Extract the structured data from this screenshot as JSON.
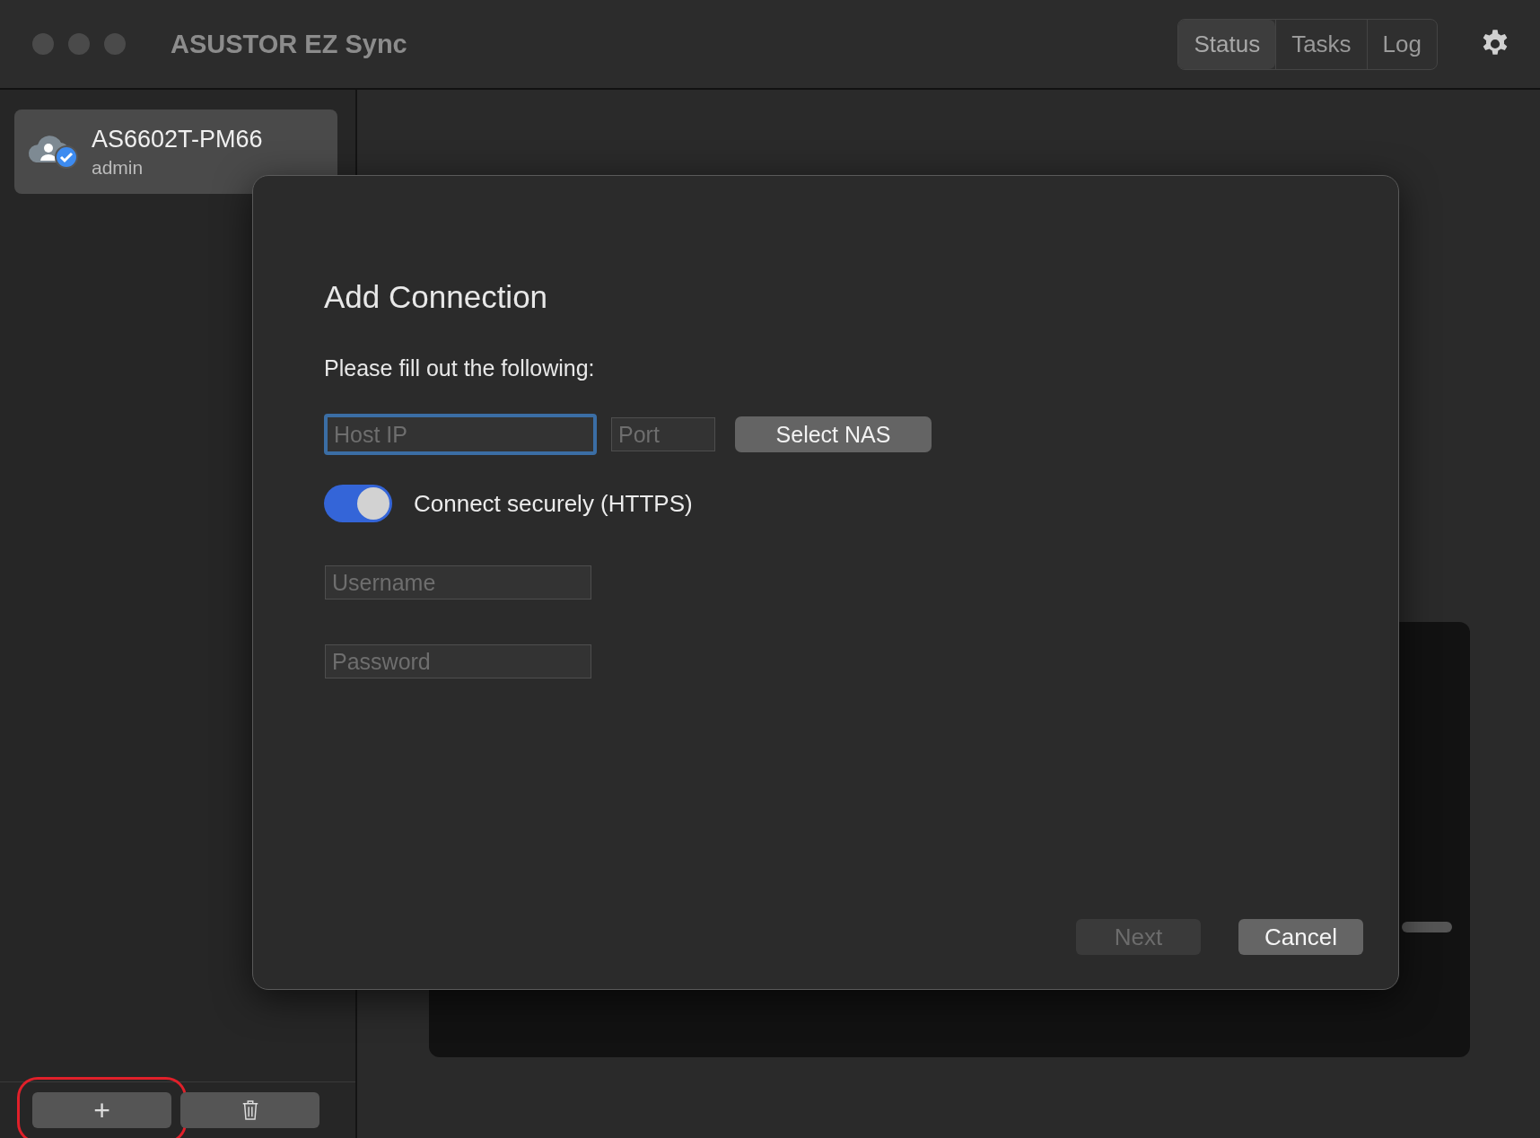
{
  "window": {
    "title": "ASUSTOR EZ Sync"
  },
  "tabs": [
    {
      "label": "Status",
      "selected": true
    },
    {
      "label": "Tasks",
      "selected": false
    },
    {
      "label": "Log",
      "selected": false
    }
  ],
  "sidebar": {
    "items": [
      {
        "name": "AS6602T-PM66",
        "user": "admin",
        "selected": true
      }
    ],
    "buttons": [
      {
        "kind": "add",
        "label": "+",
        "highlighted": true
      },
      {
        "kind": "delete",
        "highlighted": false
      }
    ]
  },
  "dialog": {
    "title": "Add Connection",
    "instruction": "Please fill out the following:",
    "host": {
      "placeholder": "Host IP",
      "focused": true
    },
    "port": {
      "placeholder": "Port",
      "focused": false
    },
    "select_button": "Select NAS",
    "secure": {
      "label": "Connect securely (HTTPS)",
      "on": true
    },
    "username": {
      "placeholder": "Username",
      "focused": false
    },
    "password": {
      "placeholder": "Password",
      "focused": false
    },
    "buttons": [
      {
        "label": "Next",
        "disabled": true
      },
      {
        "label": "Cancel",
        "disabled": false
      }
    ]
  }
}
